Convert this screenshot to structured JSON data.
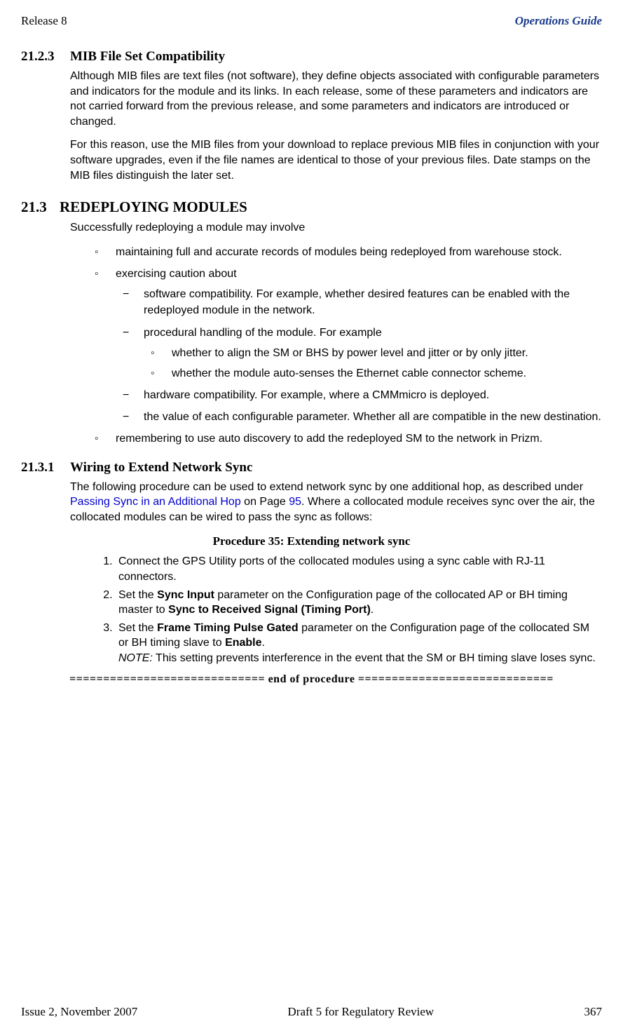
{
  "header": {
    "left": "Release 8",
    "right": "Operations Guide"
  },
  "s21_2_3": {
    "num": "21.2.3",
    "title": "MIB File Set Compatibility",
    "p1": "Although MIB files are text files (not software), they define objects associated with configurable parameters and indicators for the module and its links. In each release, some of these parameters and indicators are not carried forward from the previous release, and some parameters and indicators are introduced or changed.",
    "p2": "For this reason, use the MIB files from your download to replace previous MIB files in conjunction with your software upgrades, even if the file names are identical to those of your previous files. Date stamps on the MIB files distinguish the later set."
  },
  "s21_3": {
    "num": "21.3",
    "title": "REDEPLOYING MODULES",
    "intro": "Successfully redeploying a module may involve",
    "b1": "maintaining full and accurate records of modules being redeployed from warehouse stock.",
    "b2": "exercising caution about",
    "b2_1": "software compatibility. For example, whether desired features can be enabled with the redeployed module in the network.",
    "b2_2": "procedural handling of the module. For example",
    "b2_2_1": "whether to align the SM or BHS by power level and jitter or by only jitter.",
    "b2_2_2": "whether the module auto-senses the Ethernet cable connector scheme.",
    "b2_3": "hardware compatibility. For example, where a CMMmicro is deployed.",
    "b2_4": "the value of each configurable parameter. Whether all are compatible in the new destination.",
    "b3": "remembering to use auto discovery to add the redeployed SM to the network in Prizm."
  },
  "s21_3_1": {
    "num": "21.3.1",
    "title": "Wiring to Extend Network Sync",
    "p_pre": "The following procedure can be used to extend network sync by one additional hop, as described under ",
    "p_link": "Passing Sync in an Additional Hop",
    "p_mid": " on Page ",
    "p_page": "95",
    "p_post": ". Where a collocated module receives sync over the air, the collocated modules can be wired to pass the sync as follows:",
    "proc_title": "Procedure 35: Extending network sync",
    "step1": "Connect the GPS Utility ports of the collocated modules using a sync cable with RJ-11 connectors.",
    "step2_a": "Set the ",
    "step2_b": "Sync Input",
    "step2_c": " parameter on the Configuration page of the collocated AP or BH timing master to ",
    "step2_d": "Sync to Received Signal (Timing Port)",
    "step2_e": ".",
    "step3_a": "Set the ",
    "step3_b": "Frame Timing Pulse Gated",
    "step3_c": " parameter on the Configuration page of the collocated SM or BH timing slave to ",
    "step3_d": "Enable",
    "step3_e": ".",
    "step3_note_label": "NOTE:",
    "step3_note": " This setting prevents interference in the event that the SM or BH timing slave loses sync.",
    "end": "============================= end of procedure ============================="
  },
  "footer": {
    "left": "Issue 2, November 2007",
    "center": "Draft 5 for Regulatory Review",
    "right": "367"
  }
}
